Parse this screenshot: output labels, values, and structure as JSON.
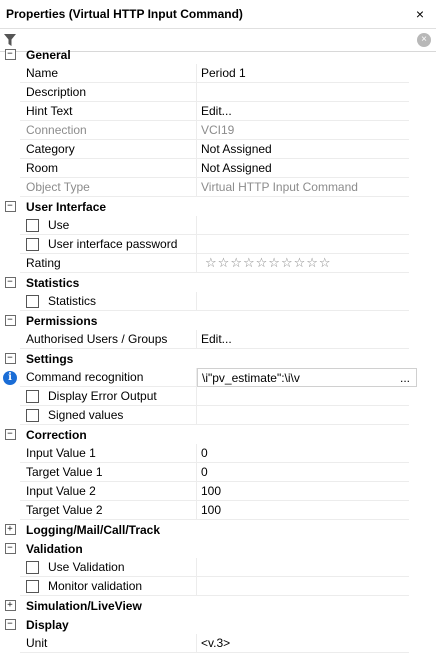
{
  "window": {
    "title": "Properties (Virtual HTTP Input Command)"
  },
  "filter": {
    "placeholder": "",
    "value": ""
  },
  "categories": {
    "general": {
      "label": "General",
      "expanded": true
    },
    "user_interface": {
      "label": "User Interface",
      "expanded": true
    },
    "statistics": {
      "label": "Statistics",
      "expanded": true
    },
    "permissions": {
      "label": "Permissions",
      "expanded": true
    },
    "settings": {
      "label": "Settings",
      "expanded": true
    },
    "correction": {
      "label": "Correction",
      "expanded": true
    },
    "logging": {
      "label": "Logging/Mail/Call/Track",
      "expanded": false
    },
    "validation": {
      "label": "Validation",
      "expanded": true
    },
    "simulation": {
      "label": "Simulation/LiveView",
      "expanded": false
    },
    "display": {
      "label": "Display",
      "expanded": true
    }
  },
  "properties": {
    "name": {
      "label": "Name",
      "value": "Period 1"
    },
    "description": {
      "label": "Description",
      "value": ""
    },
    "hint_text": {
      "label": "Hint Text",
      "value": "Edit..."
    },
    "connection": {
      "label": "Connection",
      "value": "VCI19"
    },
    "category": {
      "label": "Category",
      "value": "Not Assigned"
    },
    "room": {
      "label": "Room",
      "value": "Not Assigned"
    },
    "object_type": {
      "label": "Object Type",
      "value": "Virtual HTTP Input Command"
    },
    "use": {
      "label": "Use",
      "checked": false
    },
    "ui_password": {
      "label": "User interface password",
      "checked": false
    },
    "rating": {
      "label": "Rating",
      "value": 0,
      "max": 10
    },
    "statistics": {
      "label": "Statistics",
      "checked": false
    },
    "authorised": {
      "label": "Authorised Users / Groups",
      "value": "Edit..."
    },
    "command_recognition": {
      "label": "Command recognition",
      "value": "\\i\"pv_estimate\":\\i\\v",
      "button": "..."
    },
    "display_error_output": {
      "label": "Display Error Output",
      "checked": false
    },
    "signed_values": {
      "label": "Signed values",
      "checked": false
    },
    "input_value_1": {
      "label": "Input Value 1",
      "value": "0"
    },
    "target_value_1": {
      "label": "Target Value 1",
      "value": "0"
    },
    "input_value_2": {
      "label": "Input Value 2",
      "value": "100"
    },
    "target_value_2": {
      "label": "Target Value 2",
      "value": "100"
    },
    "use_validation": {
      "label": "Use Validation",
      "checked": false
    },
    "monitor_validation": {
      "label": "Monitor validation",
      "checked": false
    },
    "unit": {
      "label": "Unit",
      "value": "<v.3>"
    }
  },
  "icons": {
    "close": "×",
    "clear": "×",
    "expanded": "−",
    "collapsed": "+",
    "star": "☆",
    "info": "i",
    "filter": "funnel-icon"
  },
  "colors": {
    "info_blue": "#1a6dd6",
    "dim_text": "#8c8c8c"
  }
}
